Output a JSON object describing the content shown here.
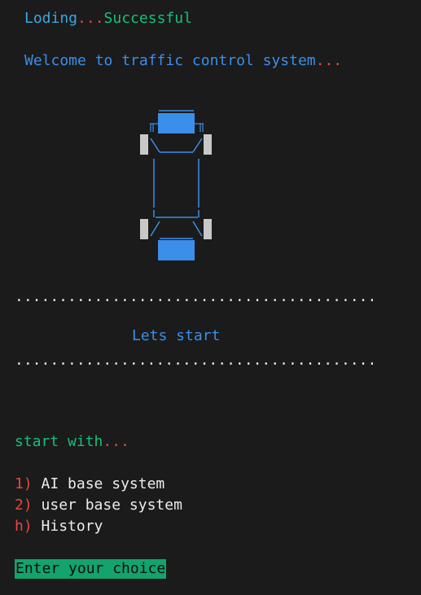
{
  "loading": {
    "text": "Loding",
    "dots": "...",
    "status": "Successful"
  },
  "welcome": {
    "text": "Welcome to traffic control system",
    "dots": "..."
  },
  "separator": ".........................................",
  "lets_start": "Lets start",
  "start_with": {
    "text": "start with",
    "dots": "..."
  },
  "menu": [
    {
      "key": "1)",
      "label": "AI base system"
    },
    {
      "key": "2)",
      "label": "user base system"
    },
    {
      "key": "h)",
      "label": "History"
    }
  ],
  "prompt": "Enter your choice",
  "colors": {
    "background": "#1b1b1b",
    "cyan": "#3aa7e0",
    "red": "#e8483f",
    "green": "#16c07a",
    "blue": "#3b8eea",
    "prompt_bg": "#13a36b"
  },
  "icons": [
    "car-ascii-icon"
  ]
}
